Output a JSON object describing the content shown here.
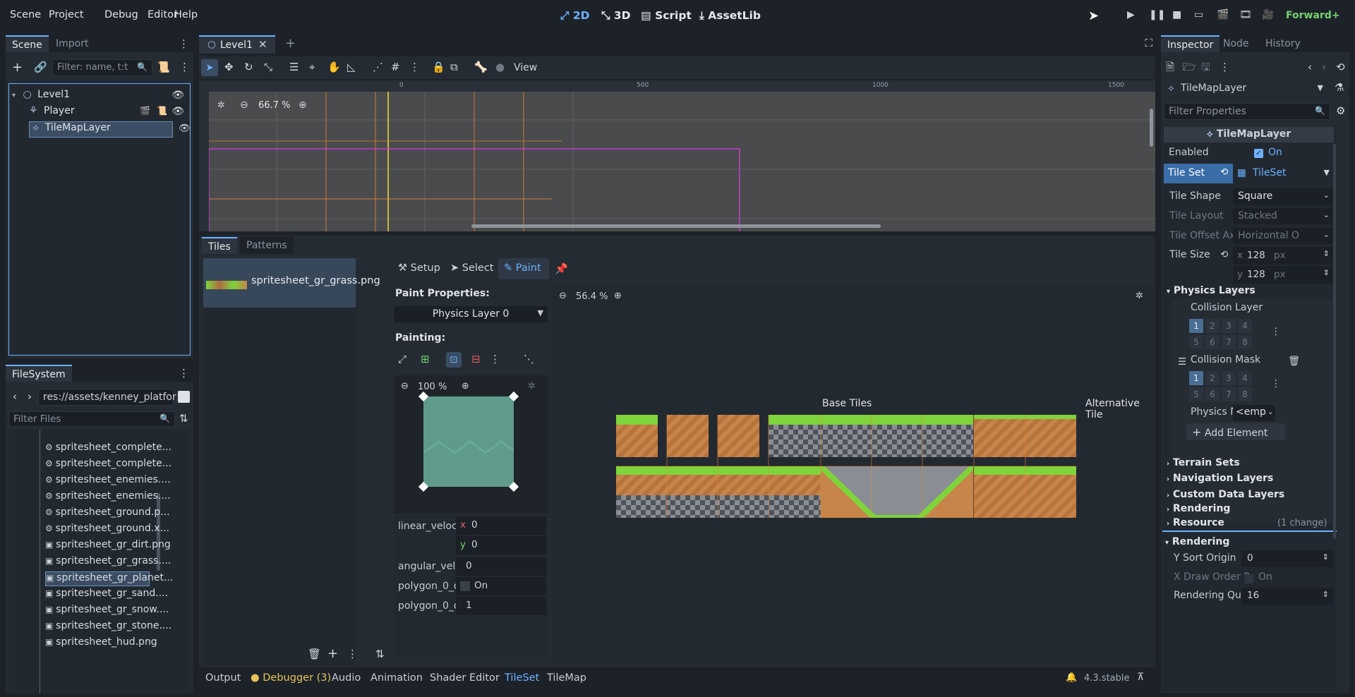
{
  "menu": [
    "Scene",
    "Project",
    "Debug",
    "Editor",
    "Help"
  ],
  "modes": {
    "m2d": "2D",
    "m3d": "3D",
    "script": "Script",
    "assetlib": "AssetLib"
  },
  "renderer": "Forward+",
  "scene_dock": {
    "tabs": [
      "Scene",
      "Import"
    ],
    "filter_placeholder": "Filter: name, t:t",
    "nodes": [
      {
        "name": "Level1",
        "icon": "node2d-icon"
      },
      {
        "name": "Player",
        "icon": "character-icon"
      },
      {
        "name": "TileMapLayer",
        "icon": "tilemap-icon"
      }
    ]
  },
  "filesystem": {
    "tab": "FileSystem",
    "path": "res://assets/kenney_platfor",
    "filter_placeholder": "Filter Files",
    "files": [
      "spritesheet_complete...",
      "spritesheet_complete...",
      "spritesheet_enemies....",
      "spritesheet_enemies....",
      "spritesheet_ground.p...",
      "spritesheet_ground.x...",
      "spritesheet_gr_dirt.png",
      "spritesheet_gr_grass....",
      "spritesheet_gr_planet...",
      "spritesheet_gr_sand....",
      "spritesheet_gr_snow....",
      "spritesheet_gr_stone....",
      "spritesheet_hud.png"
    ]
  },
  "editor_tab": "Level1",
  "view_menu": "View",
  "zoom_top": "66.7 %",
  "ruler": [
    "0",
    "500",
    "1000",
    "1500"
  ],
  "tiles_panel": {
    "tabs": [
      "Tiles",
      "Patterns"
    ],
    "source": "spritesheet_gr_grass.png",
    "tools": {
      "setup": "Setup",
      "select": "Select",
      "paint": "Paint"
    },
    "paint_properties": "Paint Properties:",
    "physics_layer": "Physics Layer 0",
    "painting": "Painting:",
    "zoom_small": "100 %",
    "props": [
      {
        "label": "linear_velocity",
        "x": "0",
        "y": "0"
      }
    ],
    "angular": {
      "label": "angular_veloci",
      "value": "0"
    },
    "poly_on": {
      "label": "polygon_0_on",
      "value": "On"
    },
    "poly_one": {
      "label": "polygon_0_on",
      "value": "1"
    },
    "zoom_atlas": "56.4 %",
    "base_tiles": "Base Tiles",
    "alt_tiles": "Alternative Tile"
  },
  "bottom_tabs": [
    "Output",
    "Debugger (3)",
    "Audio",
    "Animation",
    "Shader Editor",
    "TileSet",
    "TileMap"
  ],
  "version": "4.3.stable",
  "inspector": {
    "tabs": [
      "Inspector",
      "Node",
      "History"
    ],
    "object": "TileMapLayer",
    "filter_placeholder": "Filter Properties",
    "header": "TileMapLayer",
    "enabled_label": "Enabled",
    "enabled_value": "On",
    "tileset_label": "Tile Set",
    "tileset_value": "TileSet",
    "tile_shape": {
      "label": "Tile Shape",
      "value": "Square"
    },
    "tile_layout": {
      "label": "Tile Layout",
      "value": "Stacked"
    },
    "tile_offset": {
      "label": "Tile Offset Axis",
      "value": "Horizontal O"
    },
    "tile_size": {
      "label": "Tile Size",
      "x": "128",
      "y": "128",
      "unit": "px"
    },
    "physics_layers": "Physics Layers",
    "collision_layer": "Collision Layer",
    "collision_mask": "Collision Mask",
    "layer_nums": [
      "1",
      "2",
      "3",
      "4",
      "5",
      "6",
      "7",
      "8"
    ],
    "physics_m": {
      "label": "Physics M",
      "value": "<emp"
    },
    "add_element": "Add Element",
    "sections": [
      "Terrain Sets",
      "Navigation Layers",
      "Custom Data Layers",
      "Rendering",
      "Resource"
    ],
    "resource_change": "(1 change)",
    "rendering": "Rendering",
    "y_sort": {
      "label": "Y Sort Origin",
      "value": "0"
    },
    "x_draw": {
      "label": "X Draw Order R",
      "value": "On"
    },
    "rendering_q": {
      "label": "Rendering Qua",
      "value": "16"
    }
  },
  "colors": {
    "accent": "#6db2ff",
    "bg": "#1d2229",
    "panel": "#252b33"
  }
}
